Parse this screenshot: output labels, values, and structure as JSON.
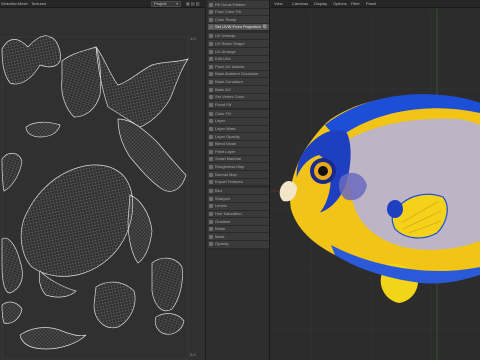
{
  "uv_editor": {
    "menu": [
      "Selection",
      "Mesh",
      "Textures"
    ],
    "dropdown_value": "Project",
    "corner_top_right": "1.0",
    "corner_bottom_right": "0.0"
  },
  "nodes": {
    "items": [
      {
        "label": "Fill Decal Pattern"
      },
      {
        "label": "Face Color Fill"
      },
      {
        "label": "Color Ramp"
      },
      {
        "label": "Set UVW From Projection",
        "selected": true,
        "settings": true
      },
      {
        "label": "UV Unwrap"
      },
      {
        "label": "UV Relax Shape"
      },
      {
        "label": "UV Arrange"
      },
      {
        "label": "Edit UVs"
      },
      {
        "label": "Pack UV Islands"
      },
      {
        "label": "Bake Ambient Occlusion"
      },
      {
        "label": "Bake Curvature"
      },
      {
        "label": "Bake AO"
      },
      {
        "label": "Set Vertex Color"
      },
      {
        "label": "Flood Fill"
      },
      {
        "label": "Color Fill"
      },
      {
        "label": "Layer"
      },
      {
        "label": "Layer Mask"
      },
      {
        "label": "Layer Opacity"
      },
      {
        "label": "Blend Mode"
      },
      {
        "label": "Paint Layer"
      },
      {
        "label": "Smart Material"
      },
      {
        "label": "Roughness Map"
      },
      {
        "label": "Normal Map"
      },
      {
        "label": "Export Textures"
      },
      {
        "label": "Blur"
      },
      {
        "label": "Sharpen"
      },
      {
        "label": "Levels"
      },
      {
        "label": "Hue Saturation"
      },
      {
        "label": "Gradient"
      },
      {
        "label": "Noise"
      },
      {
        "label": "Mask"
      },
      {
        "label": "Opacity"
      }
    ]
  },
  "viewport": {
    "menu": [
      "View",
      "Cameras",
      "Display",
      "Options",
      "Filter",
      "Panel"
    ]
  },
  "colors": {
    "fish_yellow": "#f2c416",
    "fish_blue": "#1d4ed8",
    "fish_lavender": "#b7b2d8",
    "accent_grid_green": "#3a6b3a",
    "accent_axis_red": "#8a3030"
  }
}
